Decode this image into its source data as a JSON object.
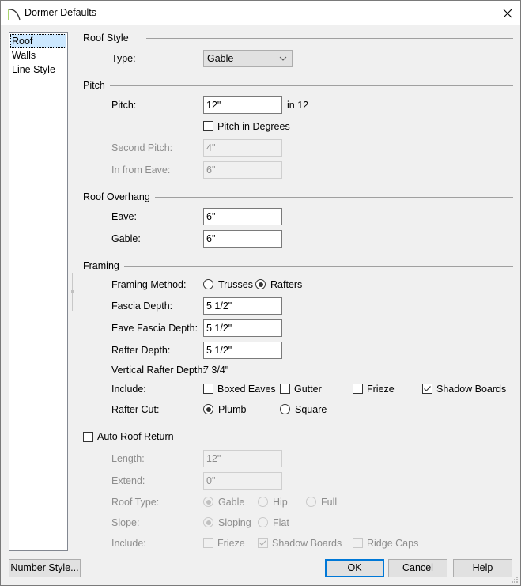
{
  "window": {
    "title": "Dormer Defaults",
    "icon": "dormer-arc-icon",
    "close_icon": "close-icon"
  },
  "sidebar": {
    "items": [
      {
        "label": "Roof",
        "selected": true
      },
      {
        "label": "Walls",
        "selected": false
      },
      {
        "label": "Line Style",
        "selected": false
      }
    ]
  },
  "roof_style": {
    "heading": "Roof Style",
    "type_label": "Type:",
    "type_value": "Gable"
  },
  "pitch": {
    "heading": "Pitch",
    "pitch_label": "Pitch:",
    "pitch_value": "12\"",
    "pitch_unit": "in 12",
    "degrees_label": "Pitch in Degrees",
    "degrees_checked": false,
    "second_pitch_label": "Second Pitch:",
    "second_pitch_value": "4\"",
    "in_from_eave_label": "In from Eave:",
    "in_from_eave_value": "6\""
  },
  "overhang": {
    "heading": "Roof Overhang",
    "eave_label": "Eave:",
    "eave_value": "6\"",
    "gable_label": "Gable:",
    "gable_value": "6\""
  },
  "framing": {
    "heading": "Framing",
    "method_label": "Framing Method:",
    "method_options": [
      {
        "label": "Trusses",
        "selected": false
      },
      {
        "label": "Rafters",
        "selected": true
      }
    ],
    "fascia_label": "Fascia Depth:",
    "fascia_value": "5 1/2\"",
    "eave_fascia_label": "Eave Fascia Depth:",
    "eave_fascia_value": "5 1/2\"",
    "rafter_depth_label": "Rafter Depth:",
    "rafter_depth_value": "5 1/2\"",
    "vertical_label": "Vertical Rafter Depth:",
    "vertical_value": "7 3/4\"",
    "include_label": "Include:",
    "include_options": [
      {
        "label": "Boxed Eaves",
        "checked": false
      },
      {
        "label": "Gutter",
        "checked": false
      },
      {
        "label": "Frieze",
        "checked": false
      },
      {
        "label": "Shadow Boards",
        "checked": true
      }
    ],
    "cut_label": "Rafter Cut:",
    "cut_options": [
      {
        "label": "Plumb",
        "selected": true
      },
      {
        "label": "Square",
        "selected": false
      }
    ]
  },
  "auto_return": {
    "heading": "Auto Roof Return",
    "checked": false,
    "length_label": "Length:",
    "length_value": "12\"",
    "extend_label": "Extend:",
    "extend_value": "0\"",
    "roof_type_label": "Roof Type:",
    "roof_type_options": [
      {
        "label": "Gable",
        "selected": true
      },
      {
        "label": "Hip",
        "selected": false
      },
      {
        "label": "Full",
        "selected": false
      }
    ],
    "slope_label": "Slope:",
    "slope_options": [
      {
        "label": "Sloping",
        "selected": true
      },
      {
        "label": "Flat",
        "selected": false
      }
    ],
    "include_label": "Include:",
    "include_options": [
      {
        "label": "Frieze",
        "checked": false
      },
      {
        "label": "Shadow Boards",
        "checked": true
      },
      {
        "label": "Ridge Caps",
        "checked": false
      }
    ]
  },
  "buttons": {
    "number_style": "Number Style...",
    "ok": "OK",
    "cancel": "Cancel",
    "help": "Help"
  },
  "colors": {
    "accent": "#0078d7",
    "selection": "#cce8ff",
    "disabled_text": "#8d8d8d"
  }
}
